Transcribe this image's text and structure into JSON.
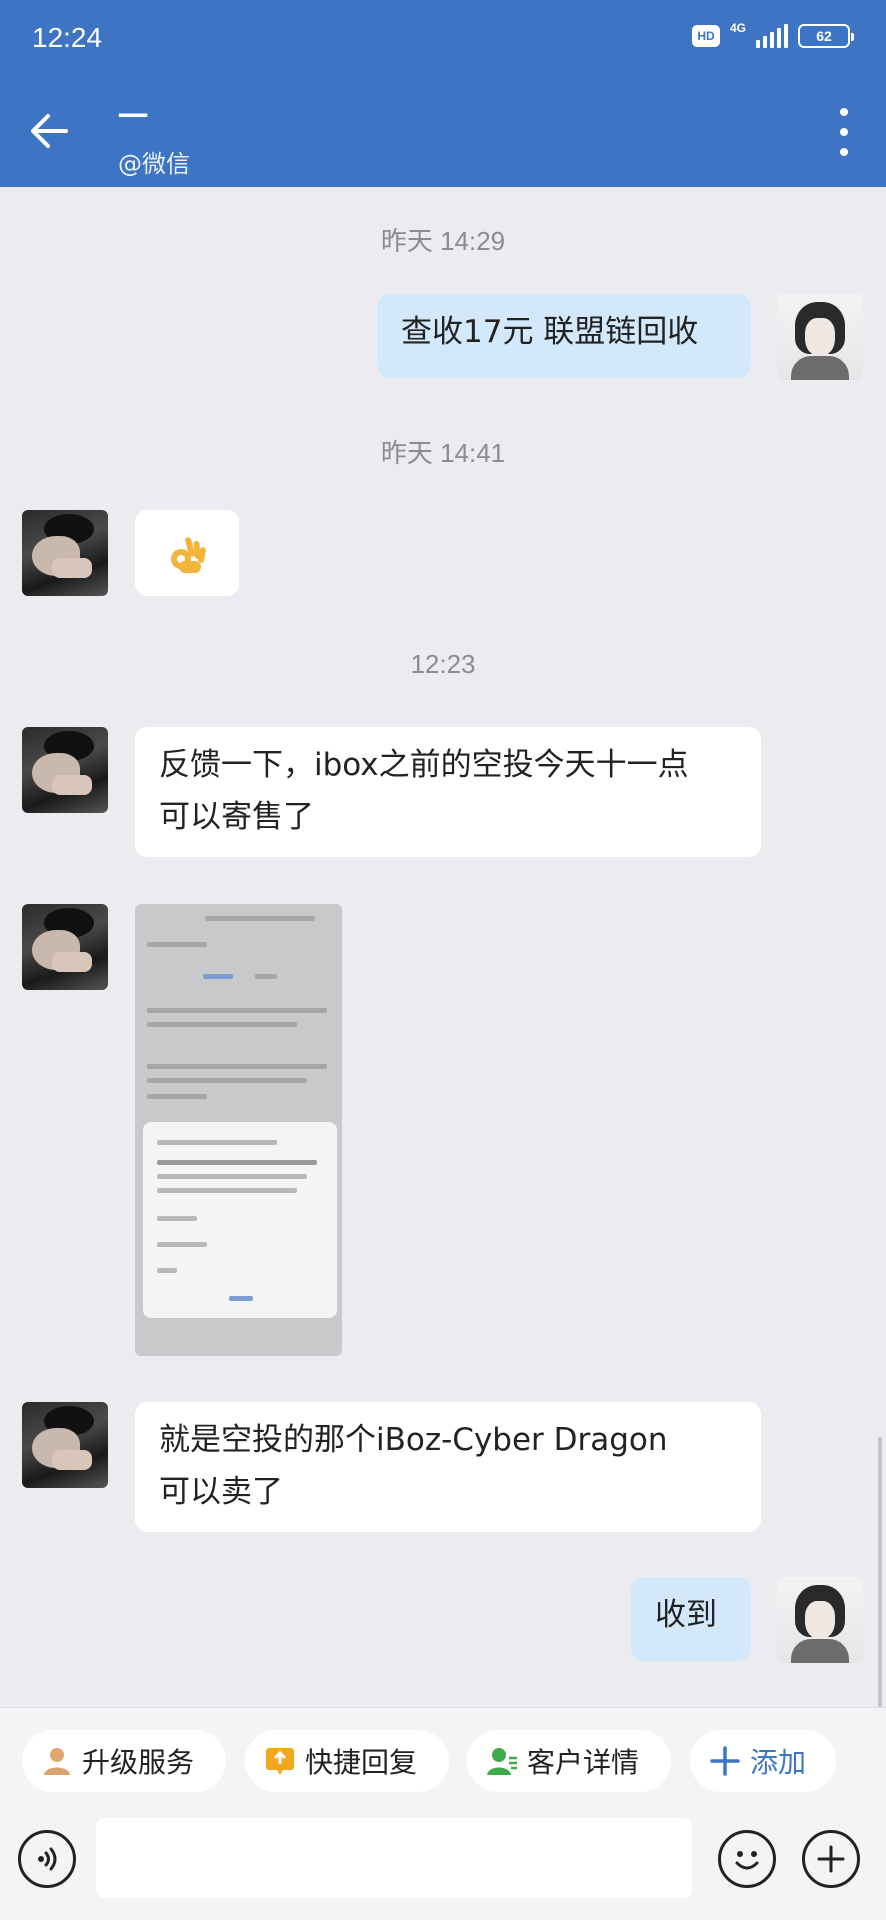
{
  "status_bar": {
    "time": "12:24",
    "hd": "HD",
    "network": "4G",
    "battery": "62"
  },
  "header": {
    "name": "一",
    "source": "@微信"
  },
  "messages": {
    "ts1": "昨天 14:29",
    "out1": "查收17元  联盟链回收",
    "ts2": "昨天 14:41",
    "ts3": "12:23",
    "in1_line1": "反馈一下，ibox之前的空投今天十一点",
    "in1_line2": "可以寄售了",
    "in2_line1": "就是空投的那个iBoz-Cyber Dragon",
    "in2_line2": "可以卖了",
    "out2": "收到"
  },
  "toolbar": {
    "upgrade": "升级服务",
    "quick_reply": "快捷回复",
    "customer_detail": "客户详情",
    "add": "添加"
  },
  "colors": {
    "header": "#3d74c4",
    "bubble_out": "#d4e8fb",
    "bubble_in": "#ffffff",
    "background": "#ececf0"
  }
}
